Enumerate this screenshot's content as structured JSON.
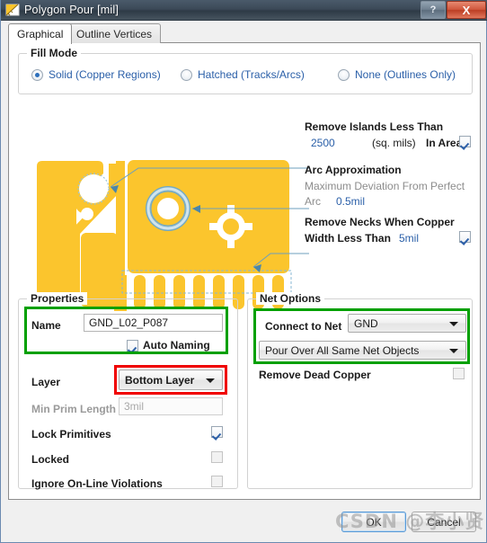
{
  "window": {
    "title": "Polygon Pour [mil]",
    "icon": "polygon-icon",
    "help_label": "?",
    "close_label": "X"
  },
  "tabs": [
    {
      "label": "Graphical",
      "active": true
    },
    {
      "label": "Outline Vertices",
      "active": false
    }
  ],
  "fill_mode": {
    "title": "Fill Mode",
    "options": [
      {
        "label": "Solid (Copper Regions)",
        "selected": true
      },
      {
        "label": "Hatched (Tracks/Arcs)",
        "selected": false
      },
      {
        "label": "None (Outlines Only)",
        "selected": false
      }
    ]
  },
  "annotations": {
    "islands": {
      "title": "Remove Islands Less Than",
      "value": "2500",
      "units": "(sq. mils)",
      "suffix": "In Area",
      "checked": true
    },
    "arc": {
      "title": "Arc Approximation",
      "description": "Maximum Deviation From Perfect",
      "label2": "Arc",
      "value": "0.5mil"
    },
    "necks": {
      "title": "Remove Necks When Copper",
      "label2": "Width Less Than",
      "value": "5mil",
      "checked": true
    }
  },
  "properties": {
    "title": "Properties",
    "name_label": "Name",
    "name_value": "GND_L02_P087",
    "auto_naming_label": "Auto Naming",
    "auto_naming_checked": true,
    "layer_label": "Layer",
    "layer_value": "Bottom Layer",
    "min_prim_label": "Min Prim Length",
    "min_prim_value": "3mil",
    "lock_primitives_label": "Lock Primitives",
    "lock_primitives_checked": true,
    "locked_label": "Locked",
    "locked_checked": false,
    "ignore_label": "Ignore On-Line Violations",
    "ignore_checked": false
  },
  "net_options": {
    "title": "Net Options",
    "connect_label": "Connect to Net",
    "connect_value": "GND",
    "pour_value": "Pour Over All Same Net Objects",
    "remove_dead_label": "Remove Dead Copper",
    "remove_dead_checked": false
  },
  "footer": {
    "ok_label": "OK",
    "cancel_label": "Cancel"
  },
  "watermark": {
    "text": "CSDN @李小贤"
  },
  "colors": {
    "copper": "#FBC52D",
    "accent_blue": "#2A5FA8",
    "highlight_green": "#00A000",
    "highlight_red": "#F00000",
    "titlebar": "#3C4A58"
  }
}
